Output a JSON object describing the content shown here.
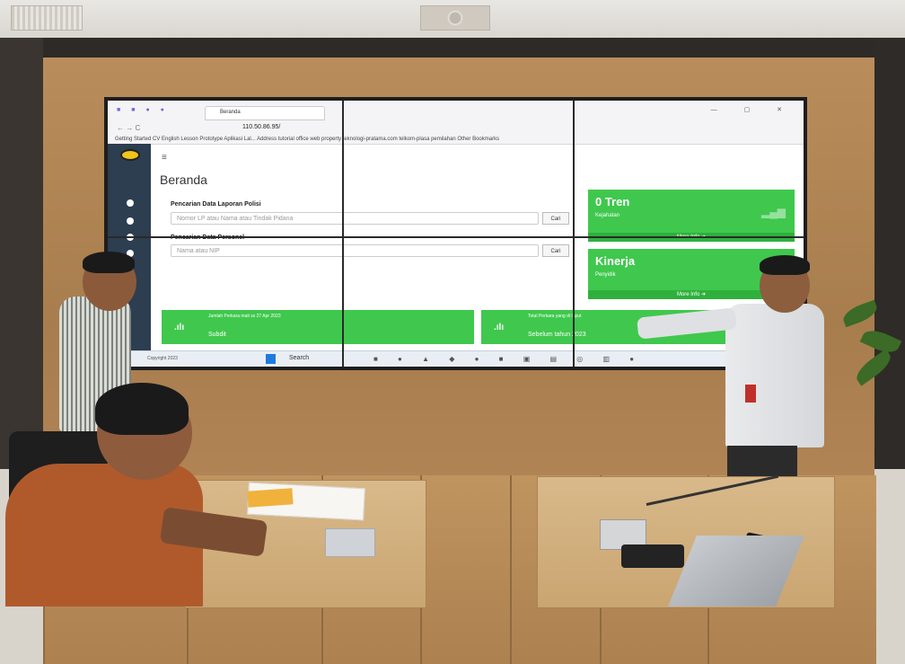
{
  "screen": {
    "browser": {
      "tab_title": "Beranda",
      "url": "110.50.86.95/",
      "bookmarks": "Getting Started   CV   English Lesson   Prototype Aplikasi Lal...   Address   tutorial   office   web property   teknologi-pratama.com   telkom-plasa   pemilahan   Other Bookmarks",
      "window_controls": "— ▢ ✕"
    },
    "app": {
      "menu_icon": "≡",
      "page_title": "Beranda",
      "search_police_label": "Pencarian Data Laporan Polisi",
      "search_police_placeholder": "Nomor LP atau Nama atau Tindak Pidana",
      "search_personnel_label": "Pencarian Data Personel",
      "search_personnel_placeholder": "Nama atau NIP",
      "search_button": "Cari",
      "cards": [
        {
          "title": "0 Tren",
          "subtitle": "Kejahatan",
          "more": "More Info ➜"
        },
        {
          "title": "Kinerja",
          "subtitle": "Penyidik",
          "more": "More Info ➜"
        }
      ],
      "info_boxes": [
        {
          "line1": "Jumlah Perkara mati ss 27 Apr 2023",
          "line2": "Subdit"
        },
        {
          "line1": "Total Perkara yang di Input",
          "line2": "Sebelum tahun 2023"
        }
      ],
      "footer_text": "Copyright 2023"
    },
    "taskbar": {
      "search_label": "Search",
      "apps": "■ ● ▲ ◆ ● ■ ▣ ▤ ◎ ▥ ●"
    }
  },
  "colors": {
    "card_green": "#3fc84d",
    "sidebar": "#2c3e50",
    "wood": "#b98d5b"
  }
}
